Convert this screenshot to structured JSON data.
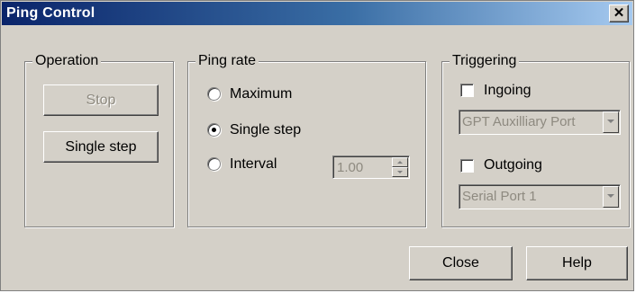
{
  "window": {
    "title": "Ping Control",
    "close_glyph": "✕"
  },
  "operation": {
    "legend": "Operation",
    "stop_label": "Stop",
    "single_step_label": "Single step"
  },
  "ping_rate": {
    "legend": "Ping rate",
    "options": [
      {
        "label": "Maximum",
        "selected": false
      },
      {
        "label": "Single step",
        "selected": true
      },
      {
        "label": "Interval",
        "selected": false
      }
    ],
    "interval_value": "1.00"
  },
  "triggering": {
    "legend": "Triggering",
    "ingoing_label": "Ingoing",
    "ingoing_checked": false,
    "ingoing_port": "GPT Auxilliary Port",
    "outgoing_label": "Outgoing",
    "outgoing_checked": false,
    "outgoing_port": "Serial Port 1"
  },
  "footer": {
    "close_label": "Close",
    "help_label": "Help"
  },
  "colors": {
    "titlebar_start": "#0a246a",
    "titlebar_end": "#a6caf0",
    "face": "#d4d0c8",
    "disabled_text": "#8e8a80"
  }
}
